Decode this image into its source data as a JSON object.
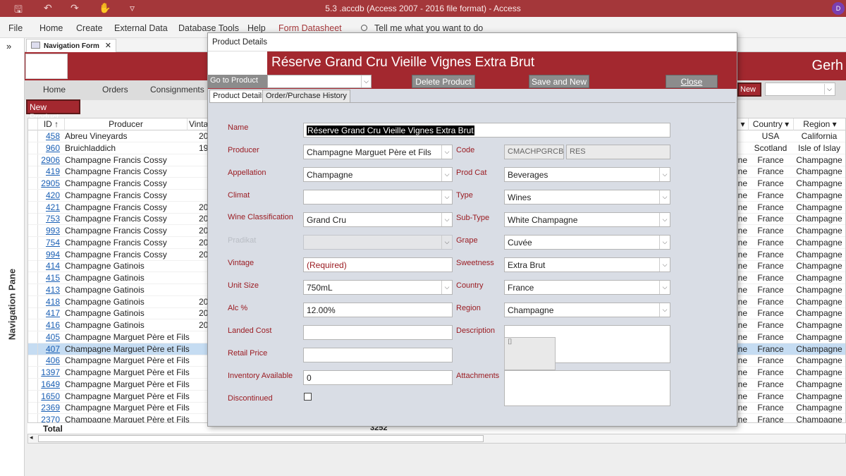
{
  "window": {
    "title": "5.3 .accdb (Access 2007 - 2016 file format)  -  Access",
    "user_initial": "D"
  },
  "quick_access": {
    "save_glyph": "🖫",
    "undo_glyph": "↶",
    "redo_glyph": "↷",
    "touch_glyph": "✋",
    "customize_glyph": "▿"
  },
  "menu": {
    "file": "File",
    "home": "Home",
    "create": "Create",
    "external": "External Data",
    "dbtools": "Database Tools",
    "help": "Help",
    "formds": "Form Datasheet",
    "tell": "Tell me what you want to do"
  },
  "nav_pane": {
    "label": "Navigation Pane",
    "chevron": "»"
  },
  "doc_tab": {
    "label": "Navigation Form",
    "close": "✕"
  },
  "form": {
    "brand_partial": "Gerh",
    "nav_buttons": [
      "Home",
      "Orders",
      "Consignments"
    ],
    "new_right": "New",
    "new_product": "New Product"
  },
  "datasheet": {
    "columns": {
      "id": "ID",
      "producer": "Producer",
      "vintage": "Vinta",
      "ne": "",
      "country": "Country",
      "region": "Region"
    },
    "rows": [
      {
        "id": "458",
        "producer": "Abreu Vineyards",
        "vintage": "20",
        "ne": "",
        "country": "USA",
        "region": "California"
      },
      {
        "id": "960",
        "producer": "Bruichladdich",
        "vintage": "19",
        "ne": "",
        "country": "Scotland",
        "region": "Isle of Islay"
      },
      {
        "id": "2906",
        "producer": "Champagne Francis Cossy",
        "vintage": "",
        "ne": "ne",
        "country": "France",
        "region": "Champagne"
      },
      {
        "id": "419",
        "producer": "Champagne Francis Cossy",
        "vintage": "",
        "ne": "ne",
        "country": "France",
        "region": "Champagne"
      },
      {
        "id": "2905",
        "producer": "Champagne Francis Cossy",
        "vintage": "",
        "ne": "ne",
        "country": "France",
        "region": "Champagne"
      },
      {
        "id": "420",
        "producer": "Champagne Francis Cossy",
        "vintage": "",
        "ne": "ne",
        "country": "France",
        "region": "Champagne"
      },
      {
        "id": "421",
        "producer": "Champagne Francis Cossy",
        "vintage": "20",
        "ne": "ne",
        "country": "France",
        "region": "Champagne"
      },
      {
        "id": "753",
        "producer": "Champagne Francis Cossy",
        "vintage": "20",
        "ne": "ne",
        "country": "France",
        "region": "Champagne"
      },
      {
        "id": "993",
        "producer": "Champagne Francis Cossy",
        "vintage": "20",
        "ne": "ne",
        "country": "France",
        "region": "Champagne"
      },
      {
        "id": "754",
        "producer": "Champagne Francis Cossy",
        "vintage": "20",
        "ne": "ne",
        "country": "France",
        "region": "Champagne"
      },
      {
        "id": "994",
        "producer": "Champagne Francis Cossy",
        "vintage": "20",
        "ne": "ne",
        "country": "France",
        "region": "Champagne"
      },
      {
        "id": "414",
        "producer": "Champagne Gatinois",
        "vintage": "",
        "ne": "ne",
        "country": "France",
        "region": "Champagne"
      },
      {
        "id": "415",
        "producer": "Champagne Gatinois",
        "vintage": "",
        "ne": "ne",
        "country": "France",
        "region": "Champagne"
      },
      {
        "id": "413",
        "producer": "Champagne Gatinois",
        "vintage": "",
        "ne": "ne",
        "country": "France",
        "region": "Champagne"
      },
      {
        "id": "418",
        "producer": "Champagne Gatinois",
        "vintage": "20",
        "ne": "ne",
        "country": "France",
        "region": "Champagne"
      },
      {
        "id": "417",
        "producer": "Champagne Gatinois",
        "vintage": "20",
        "ne": "ne",
        "country": "France",
        "region": "Champagne"
      },
      {
        "id": "416",
        "producer": "Champagne Gatinois",
        "vintage": "20",
        "ne": "ne",
        "country": "France",
        "region": "Champagne"
      },
      {
        "id": "405",
        "producer": "Champagne Marguet Père et Fils",
        "vintage": "",
        "ne": "ne",
        "country": "France",
        "region": "Champagne"
      },
      {
        "id": "407",
        "producer": "Champagne Marguet Père et Fils",
        "vintage": "",
        "ne": "ne",
        "country": "France",
        "region": "Champagne"
      },
      {
        "id": "406",
        "producer": "Champagne Marguet Père et Fils",
        "vintage": "",
        "ne": "ne",
        "country": "France",
        "region": "Champagne"
      },
      {
        "id": "1397",
        "producer": "Champagne Marguet Père et Fils",
        "vintage": "",
        "ne": "ne",
        "country": "France",
        "region": "Champagne"
      },
      {
        "id": "1649",
        "producer": "Champagne Marguet Père et Fils",
        "vintage": "",
        "ne": "ne",
        "country": "France",
        "region": "Champagne"
      },
      {
        "id": "1650",
        "producer": "Champagne Marguet Père et Fils",
        "vintage": "",
        "ne": "ne",
        "country": "France",
        "region": "Champagne"
      },
      {
        "id": "2369",
        "producer": "Champagne Marguet Père et Fils",
        "vintage": "",
        "ne": "ne",
        "country": "France",
        "region": "Champagne"
      },
      {
        "id": "2370",
        "producer": "Champagne Marguet Père et Fils",
        "vintage": "",
        "ne": "ne",
        "country": "France",
        "region": "Champagne"
      }
    ],
    "selected_id": "407",
    "total_label": "Total",
    "total_value": "3252"
  },
  "dialog": {
    "title": "Product Details",
    "heading": "Réserve Grand Cru Vieille Vignes Extra Brut",
    "goto_label": "Go to Product",
    "delete": "Delete Product",
    "save_new": "Save and New",
    "close": "Close",
    "tabs": [
      "Product Details",
      "Order/Purchase History"
    ],
    "labels": {
      "name": "Name",
      "producer": "Producer",
      "appellation": "Appellation",
      "climat": "Climat",
      "wine_class": "Wine Classification",
      "pradikat": "Pradikat",
      "vintage": "Vintage",
      "unit_size": "Unit Size",
      "alc": "Alc %",
      "landed": "Landed Cost",
      "retail": "Retail Price",
      "inventory": "Inventory Available",
      "discontinued": "Discontinued",
      "code": "Code",
      "prod_cat": "Prod Cat",
      "type": "Type",
      "sub_type": "Sub-Type",
      "grape": "Grape",
      "sweetness": "Sweetness",
      "country": "Country",
      "region": "Region",
      "description": "Description",
      "attachments": "Attachments"
    },
    "values": {
      "name": "Réserve Grand Cru Vieille Vignes Extra Brut",
      "producer": "Champagne Marguet Père et Fils",
      "appellation": "Champagne",
      "climat": "",
      "wine_class": "Grand Cru",
      "pradikat": "",
      "vintage": "(Required)",
      "unit_size": "750mL",
      "alc": "12.00%",
      "landed": "",
      "retail": "",
      "inventory": "0",
      "discontinued": false,
      "code": "CMACHPGRCB",
      "code2": "RES",
      "prod_cat": "Beverages",
      "type": "Wines",
      "sub_type": "White Champagne",
      "grape": "Cuvée",
      "sweetness": "Extra Brut",
      "country": "France",
      "region": "Champagne",
      "description": ""
    }
  },
  "colors": {
    "brand": "#a3282f",
    "title_bar": "#a4373a",
    "selected_row": "#c5dcf2",
    "label": "#9b1c22"
  }
}
